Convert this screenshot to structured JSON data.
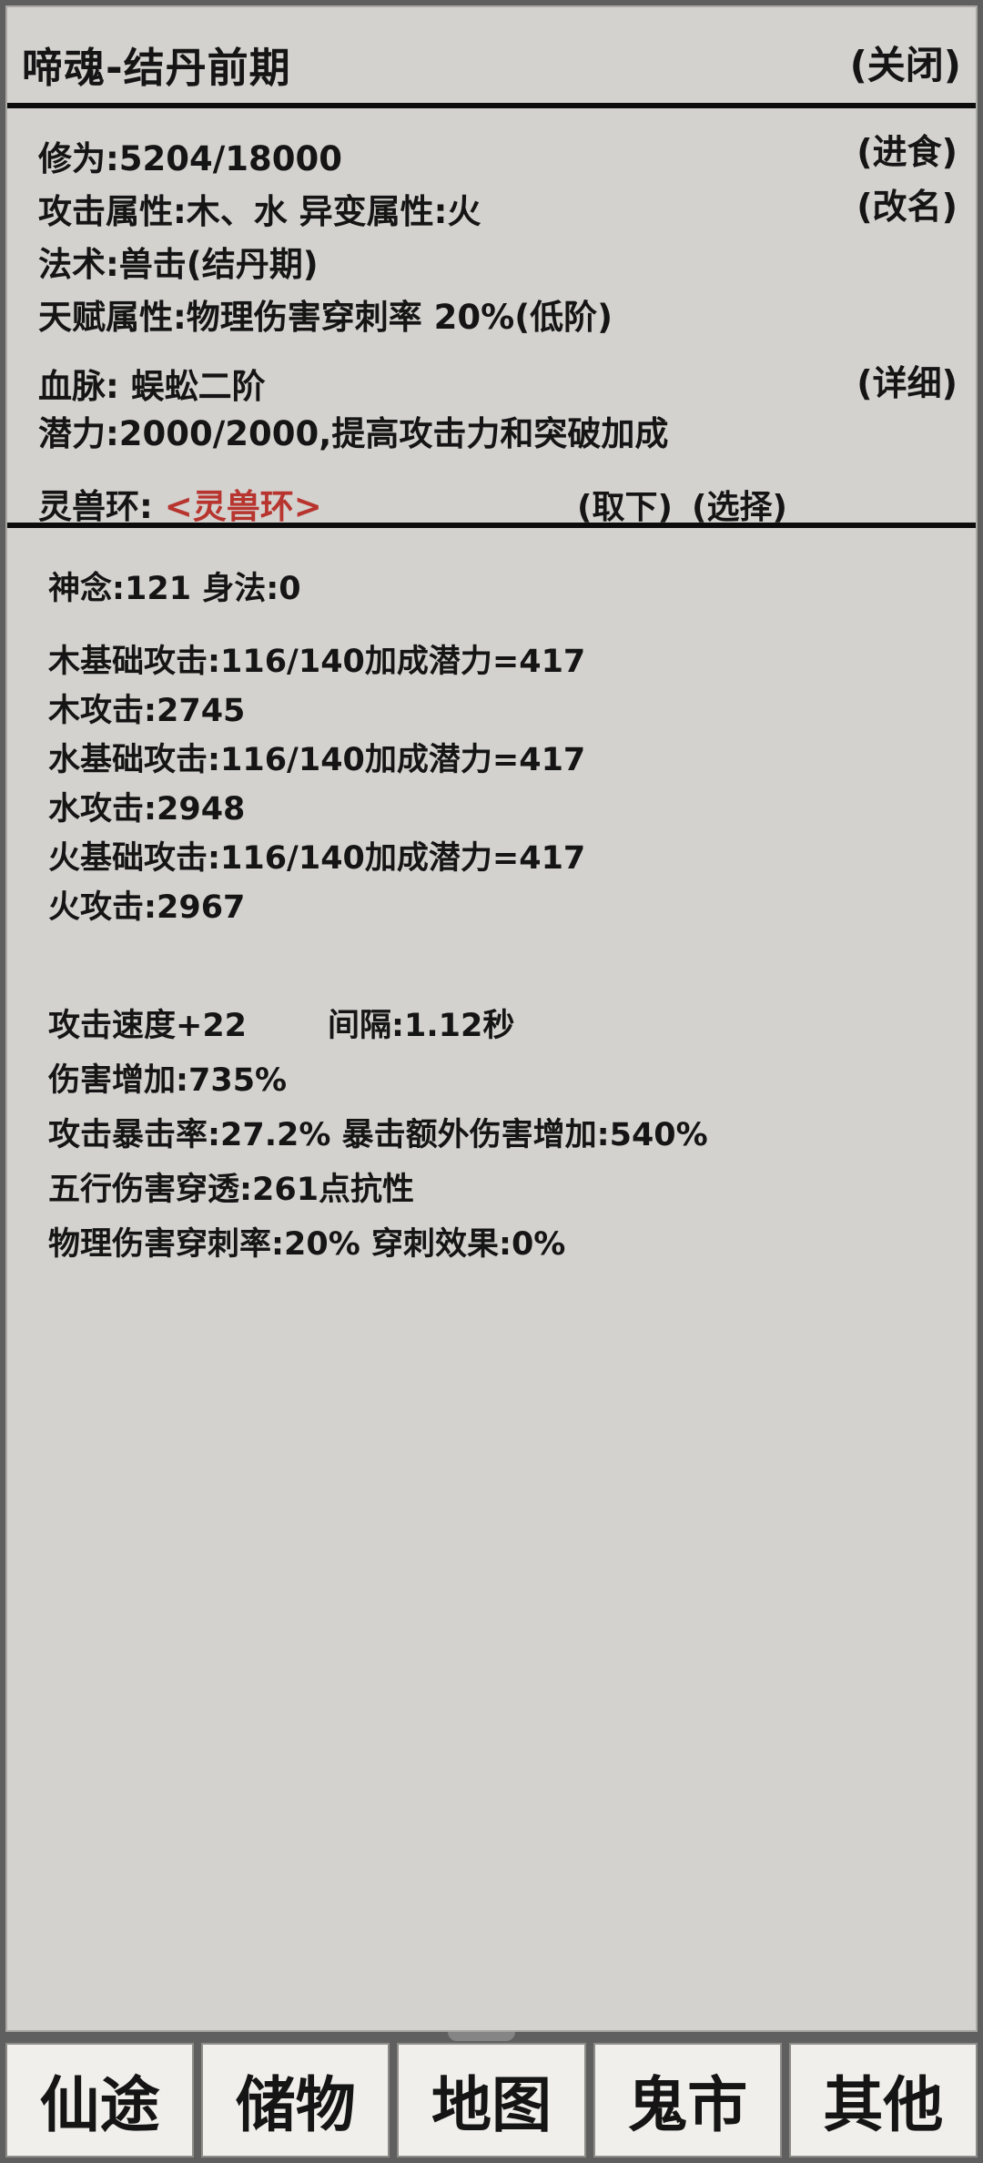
{
  "header": {
    "title": "啼魂-结丹前期",
    "close_label": "(关闭)"
  },
  "info": {
    "cultivation": "修为:5204/18000",
    "feed_label": "(进食)",
    "attributes": "攻击属性:木、水 异变属性:火",
    "rename_label": "(改名)",
    "spell": "法术:兽击(结丹期)",
    "talent": "天赋属性:物理伤害穿刺率 20%(低阶)",
    "bloodline": "血脉: 蜈蚣二阶",
    "detail_label": "(详细)",
    "potential": "潜力:2000/2000,提高攻击力和突破加成",
    "beast_ring_label": "灵兽环:",
    "beast_ring_value": "<灵兽环>",
    "remove_label": "(取下)",
    "select_label": "(选择)"
  },
  "stats": {
    "spirit_move": "神念:121  身法:0",
    "wood_base": "木基础攻击:116/140加成潜力=417",
    "wood_attack": "木攻击:2745",
    "water_base": "水基础攻击:116/140加成潜力=417",
    "water_attack": "水攻击:2948",
    "fire_base": "火基础攻击:116/140加成潜力=417",
    "fire_attack": "火攻击:2967",
    "attack_speed": "攻击速度+22",
    "interval": "间隔:1.12秒",
    "damage_increase": "伤害增加:735%",
    "crit": "攻击暴击率:27.2%  暴击额外伤害增加:540%",
    "elemental_penetration": "五行伤害穿透:261点抗性",
    "physical_pierce": "物理伤害穿刺率:20% 穿刺效果:0%"
  },
  "bottom_nav": [
    {
      "label": "仙途"
    },
    {
      "label": "储物"
    },
    {
      "label": "地图"
    },
    {
      "label": "鬼市"
    },
    {
      "label": "其他"
    }
  ],
  "colors": {
    "panel_bg": "#d3d2cf",
    "frame": "#5f5f5f",
    "divider": "#0c0c0c",
    "text": "#151515",
    "accent_red": "#b8342e",
    "nav_bg": "#f0efeb"
  }
}
